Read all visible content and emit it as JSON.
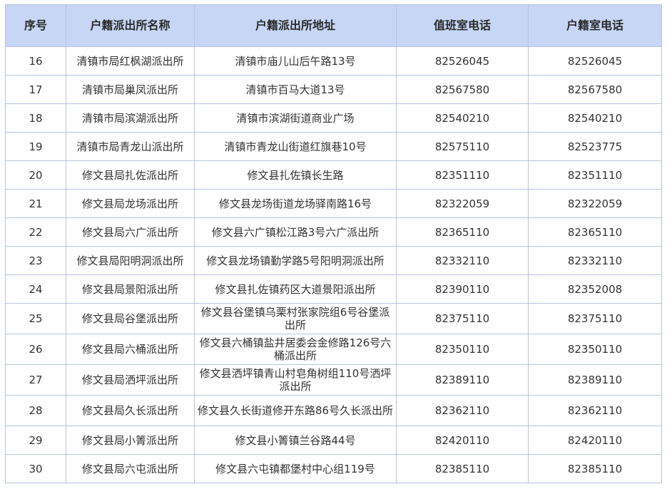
{
  "table": {
    "headers": [
      "序号",
      "户籍派出所名称",
      "户籍派出所地址",
      "值班室电话",
      "户籍室电话"
    ],
    "rows": [
      [
        "16",
        "清镇市局红枫湖派出所",
        "清镇市庙儿山后午路13号",
        "82526045",
        "82526045"
      ],
      [
        "17",
        "清镇市局巢凤派出所",
        "清镇市百马大道13号",
        "82567580",
        "82567580"
      ],
      [
        "18",
        "清镇市局滨湖派出所",
        "清镇市滨湖街道商业广场",
        "82540210",
        "82540210"
      ],
      [
        "19",
        "清镇市局青龙山派出所",
        "清镇市青龙山街道红旗巷10号",
        "82575110",
        "82523775"
      ],
      [
        "20",
        "修文县局扎佐派出所",
        "修文县扎佐镇长生路",
        "82351110",
        "82351110"
      ],
      [
        "21",
        "修文县局龙场派出所",
        "修文县龙场街道龙场驿南路16号",
        "82322059",
        "82322059"
      ],
      [
        "22",
        "修文县局六广派出所",
        "修文县六广镇松江路3号六广派出所",
        "82365110",
        "82365110"
      ],
      [
        "23",
        "修文县局阳明洞派出所",
        "修文县龙场镇勤学路5号阳明洞派出所",
        "82332110",
        "82332110"
      ],
      [
        "24",
        "修文县局景阳派出所",
        "修文县扎佐镇药区大道景阳派出所",
        "82390110",
        "82352008"
      ],
      [
        "25",
        "修文县局谷堡派出所",
        "修文县谷堡镇乌栗村张家院组6号谷堡派出所",
        "82375110",
        "82375110"
      ],
      [
        "26",
        "修文县局六桶派出所",
        "修文县六桶镇盐井居委会金修路126号六桶派出所",
        "82350110",
        "82350110"
      ],
      [
        "27",
        "修文县局洒坪派出所",
        "修文县洒坪镇青山村皂角树组110号洒坪派出所",
        "82389110",
        "82389110"
      ],
      [
        "28",
        "修文县局久长派出所",
        "修文县久长街道修开东路86号久长派出所",
        "82362110",
        "82362110"
      ],
      [
        "29",
        "修文县局小箐派出所",
        "修文县小箐镇兰谷路44号",
        "82420110",
        "82420110"
      ],
      [
        "30",
        "修文县局六屯派出所",
        "修文县六屯镇都堡村中心组119号",
        "82385110",
        "82385110"
      ]
    ]
  }
}
